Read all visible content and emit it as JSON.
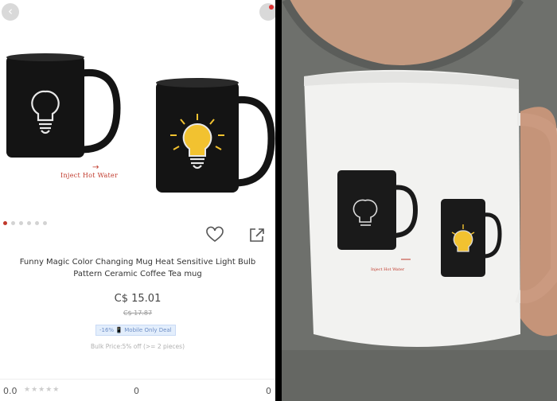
{
  "colors": {
    "accent": "#c0392b",
    "bulb_glow": "#f2c230",
    "mug_black": "#141414",
    "deal_blue": "#6f8fc6"
  },
  "header": {
    "back_icon": "chevron-left-icon",
    "corner_icon": "close-icon"
  },
  "gallery": {
    "caption": "Inject  Hot Water",
    "arrow": "→",
    "pages": 6,
    "active_page": 1
  },
  "actions": {
    "wishlist_icon": "heart-icon",
    "share_icon": "share-icon"
  },
  "product": {
    "title_line1": "Funny Magic Color Changing Mug Heat Sensitive Light Bulb",
    "title_line2": "Pattern Ceramic Coffee Tea mug",
    "price": "C$ 15.01",
    "old_price": "C$ 17.87",
    "deal_badge": "-16% 📱 Mobile Only Deal",
    "bulk_note": "Bulk Price:5% off (>= 2 pieces)"
  },
  "stats": {
    "rating": "0.0",
    "stars_shown": "★★★★★",
    "star_count": 5,
    "orders": "0",
    "reviews": "0"
  },
  "photo": {
    "mug_print_caption": "Inject  Hot Water"
  }
}
